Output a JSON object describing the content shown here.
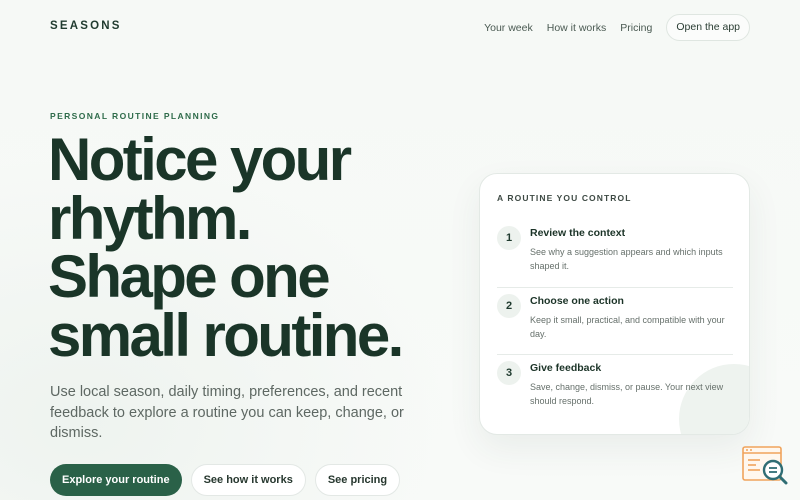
{
  "nav": {
    "brand": "SEASONS",
    "links": [
      "Your week",
      "How it works",
      "Pricing"
    ],
    "cta": "Open the app"
  },
  "hero": {
    "eyebrow": "PERSONAL ROUTINE PLANNING",
    "headline_lines": [
      "Notice your",
      "rhythm.",
      "Shape one",
      "small routine."
    ],
    "lede": "Use local season, daily timing, preferences, and recent feedback to explore a routine you can keep, change, or dismiss.",
    "buttons": {
      "primary": "Explore your routine",
      "secondary": "See how it works",
      "tertiary": "See pricing"
    }
  },
  "card": {
    "title": "A ROUTINE YOU CONTROL",
    "steps": [
      {
        "num": "1",
        "title": "Review the context",
        "desc": "See why a suggestion appears and which inputs shaped it."
      },
      {
        "num": "2",
        "title": "Choose one action",
        "desc": "Keep it small, practical, and compatible with your day."
      },
      {
        "num": "3",
        "title": "Give feedback",
        "desc": "Save, change, dismiss, or pause. Your next view should respond."
      }
    ]
  },
  "widget": {
    "icon": "search-document-icon",
    "accent": "#f0a35c",
    "lens_color": "#2f6d74"
  }
}
